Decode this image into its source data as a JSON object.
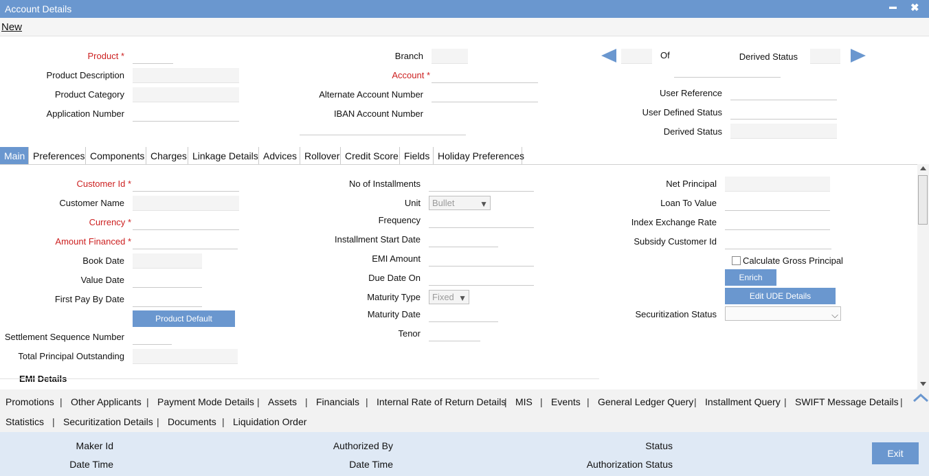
{
  "window": {
    "title": "Account Details",
    "minimize": "▬",
    "close": "✖"
  },
  "toolbar": {
    "new_label": "New"
  },
  "header": {
    "product_label": "Product",
    "product_desc_label": "Product Description",
    "product_category_label": "Product Category",
    "application_number_label": "Application Number",
    "branch_label": "Branch",
    "account_label": "Account",
    "alt_account_label": "Alternate Account Number",
    "iban_label": "IBAN Account Number",
    "of_label": "Of",
    "derived_status_label_top": "Derived Status",
    "user_reference_label": "User Reference",
    "user_defined_status_label": "User Defined Status",
    "derived_status_label": "Derived Status"
  },
  "required_mark": "*",
  "tabs": [
    "Main",
    "Preferences",
    "Components",
    "Charges",
    "Linkage Details",
    "Advices",
    "Rollover",
    "Credit Score",
    "Fields",
    "Holiday Preferences"
  ],
  "main": {
    "customer_id_label": "Customer Id",
    "customer_name_label": "Customer Name",
    "currency_label": "Currency",
    "amount_financed_label": "Amount Financed",
    "book_date_label": "Book Date",
    "value_date_label": "Value Date",
    "first_pay_label": "First Pay By Date",
    "product_default_btn": "Product Default",
    "settlement_seq_label": "Settlement Sequence Number",
    "total_principal_label": "Total Principal Outstanding",
    "no_installments_label": "No of Installments",
    "unit_label": "Unit",
    "unit_value": "Bullet",
    "frequency_label": "Frequency",
    "installment_start_label": "Installment Start Date",
    "emi_amount_label": "EMI Amount",
    "due_date_on_label": "Due Date On",
    "maturity_type_label": "Maturity Type",
    "maturity_type_value": "Fixed",
    "maturity_date_label": "Maturity Date",
    "tenor_label": "Tenor",
    "net_principal_label": "Net Principal",
    "loan_to_value_label": "Loan To Value",
    "index_exchange_label": "Index Exchange Rate",
    "subsidy_customer_label": "Subsidy Customer Id",
    "calc_gross_label": "Calculate Gross Principal",
    "enrich_btn": "Enrich",
    "edit_ude_btn": "Edit UDE Details",
    "securitization_label": "Securitization Status",
    "emi_details_label": "EMI Details"
  },
  "links_row1": [
    "Promotions",
    "Other Applicants",
    "Payment Mode Details",
    "Assets",
    "Financials",
    "Internal Rate of Return Details",
    "MIS",
    "Events",
    "General Ledger Query",
    "Installment Query",
    "SWIFT Message Details"
  ],
  "links_row2": [
    "Statistics",
    "Securitization Details",
    "Documents",
    "Liquidation Order"
  ],
  "separator": "|",
  "footer": {
    "maker_id": "Maker Id",
    "date_time_1": "Date Time",
    "authorized_by": "Authorized By",
    "date_time_2": "Date Time",
    "status": "Status",
    "authorization_status": "Authorization Status",
    "exit_btn": "Exit"
  },
  "colors": {
    "accent": "#6a97cf",
    "required": "#cc1f1f",
    "footer_bg": "#dfe9f5"
  }
}
